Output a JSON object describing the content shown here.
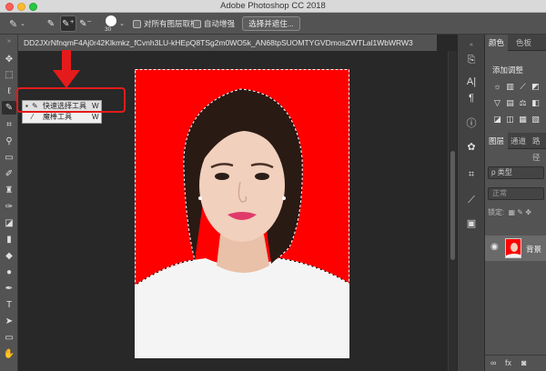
{
  "window": {
    "title": "Adobe Photoshop CC 2018"
  },
  "options_bar": {
    "brush_size": "30",
    "sample_all_layers_label": "对所有图层取样",
    "auto_enhance_label": "自动增强",
    "select_and_mask_label": "选择并遮住..."
  },
  "document": {
    "tab_title": "DD2JXrNfnqmF4Aj0r42Klkmkz_fCvnh3LU-kHEpQ8TSg2m0WO5k_AN68tpSUOMTYGVDmosZWTLal1WbWRW3"
  },
  "flyout": {
    "items": [
      {
        "label": "快速选择工具",
        "shortcut": "W",
        "selected": true
      },
      {
        "label": "魔棒工具",
        "shortcut": "W",
        "selected": false
      }
    ]
  },
  "panels": {
    "top_tabs": [
      "颜色",
      "色板"
    ],
    "adjustments_label": "添加调整",
    "layer_tabs": [
      "图层",
      "通道",
      "路径"
    ],
    "search_placeholder": "ρ 类型",
    "blend_mode": "正常",
    "lock_label": "锁定:",
    "layer": {
      "name": "背景"
    }
  },
  "colors": {
    "photo_background": "#ff0000",
    "annotation": "#e51b1b"
  }
}
